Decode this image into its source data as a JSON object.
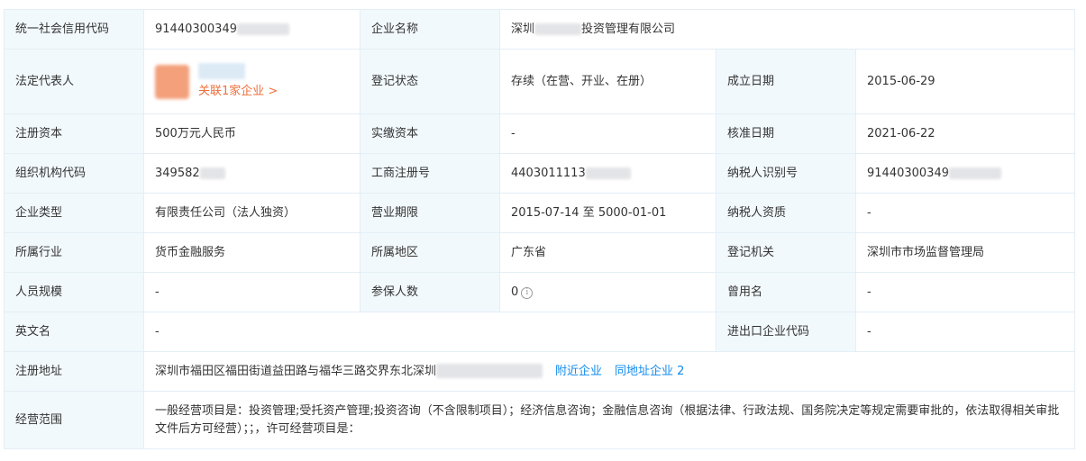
{
  "labels": {
    "credit_code": "统一社会信用代码",
    "company_name": "企业名称",
    "legal_rep": "法定代表人",
    "reg_status": "登记状态",
    "established": "成立日期",
    "reg_capital": "注册资本",
    "paid_capital": "实缴资本",
    "approved_date": "核准日期",
    "org_code": "组织机构代码",
    "business_reg_no": "工商注册号",
    "taxpayer_id": "纳税人识别号",
    "company_type": "企业类型",
    "business_term": "营业期限",
    "taxpayer_qual": "纳税人资质",
    "industry": "所属行业",
    "region": "所属地区",
    "reg_authority": "登记机关",
    "staff_size": "人员规模",
    "insured_count": "参保人数",
    "former_name": "曾用名",
    "english_name": "英文名",
    "import_export_code": "进出口企业代码",
    "reg_address": "注册地址",
    "business_scope": "经营范围"
  },
  "values": {
    "credit_code": "91440300349",
    "company_name_prefix": "深圳",
    "company_name_suffix": "投资管理有限公司",
    "legal_rep_link": "关联1家企业 >",
    "reg_status": "存续（在营、开业、在册）",
    "established": "2015-06-29",
    "reg_capital": "500万元人民币",
    "paid_capital": "-",
    "approved_date": "2021-06-22",
    "org_code": "349582",
    "business_reg_no": "4403011113",
    "taxpayer_id": "91440300349",
    "company_type": "有限责任公司（法人独资）",
    "business_term": "2015-07-14 至 5000-01-01",
    "taxpayer_qual": "-",
    "industry": "货币金融服务",
    "region": "广东省",
    "reg_authority": "深圳市市场监督管理局",
    "staff_size": "-",
    "insured_count": "0",
    "former_name": "-",
    "english_name": "-",
    "import_export_code": "-",
    "reg_address": "深圳市福田区福田街道益田路与福华三路交界东北深圳",
    "nearby_link": "附近企业",
    "same_address_link": "同地址企业 2",
    "business_scope": "一般经营项目是：投资管理;受托资产管理;投资咨询（不含限制项目）；经济信息咨询；金融信息咨询（根据法律、行政法规、国务院决定等规定需要审批的，依法取得相关审批文件后方可经营）；；，许可经营项目是："
  },
  "icons": {
    "insured_info": "info-icon"
  },
  "colors": {
    "label_bg": "#f2f9fc",
    "border": "#e4eef6",
    "link_blue": "#128bed",
    "link_orange": "#ee6f3a"
  }
}
